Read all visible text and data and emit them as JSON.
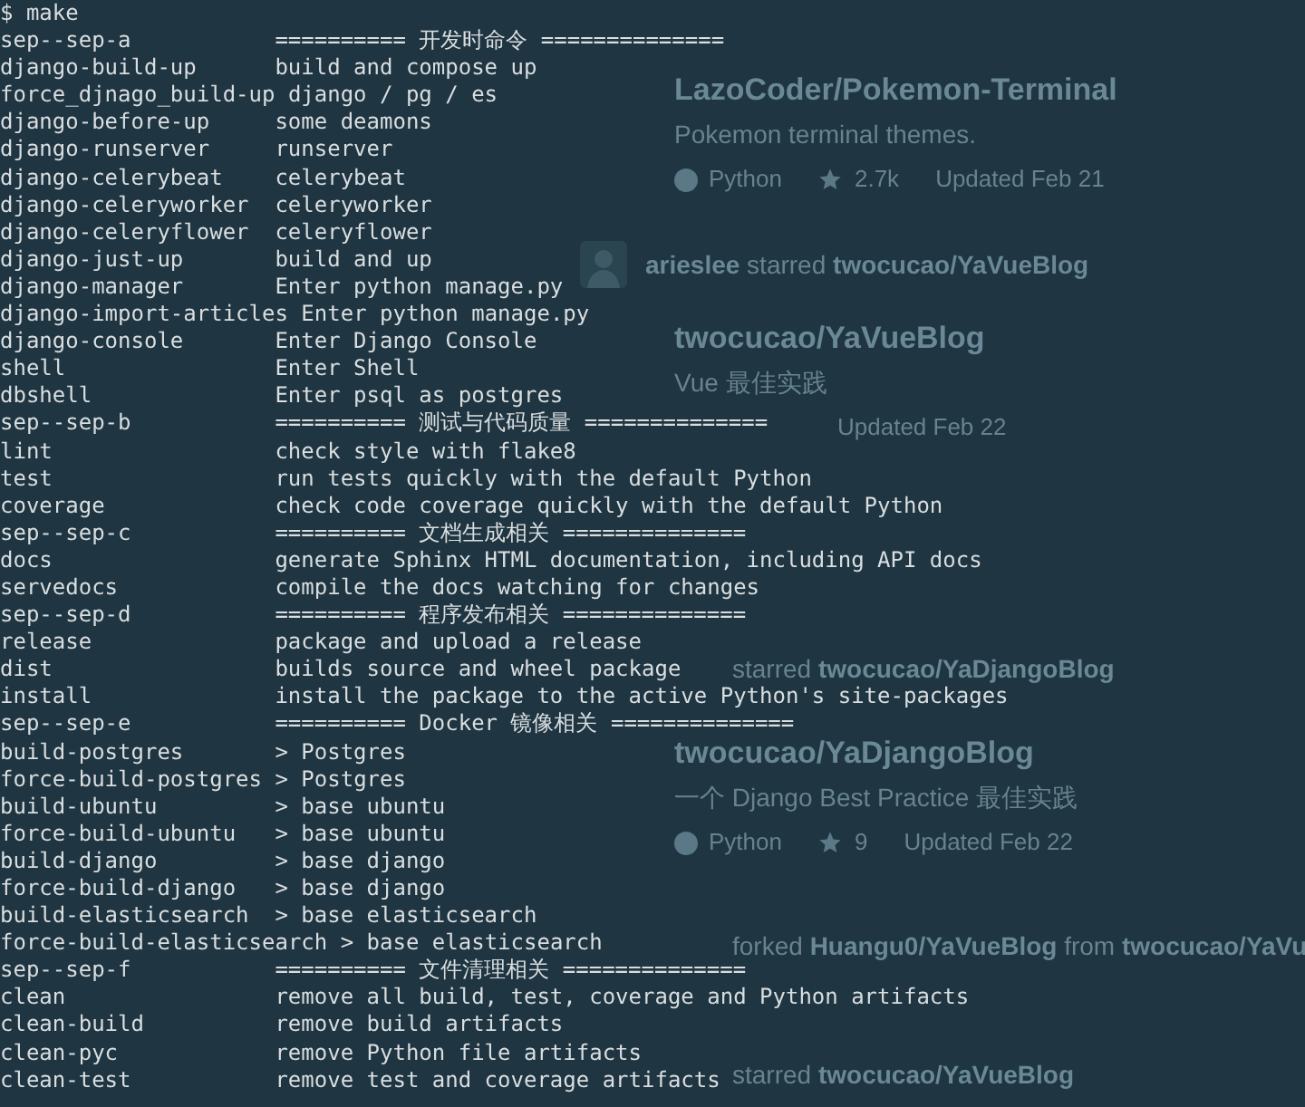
{
  "prompt": "$ make",
  "lines": [
    {
      "name": "sep--sep-a",
      "description": "========== 开发时命令 =============="
    },
    {
      "name": "django-build-up",
      "description": "build and compose up"
    },
    {
      "name": "force_djnago_build-up",
      "description": "django / pg / es"
    },
    {
      "name": "django-before-up",
      "description": "some deamons"
    },
    {
      "name": "django-runserver",
      "description": "runserver"
    },
    {
      "name": "django-celerybeat",
      "description": "celerybeat"
    },
    {
      "name": "django-celeryworker",
      "description": "celeryworker"
    },
    {
      "name": "django-celeryflower",
      "description": "celeryflower"
    },
    {
      "name": "django-just-up",
      "description": "build and up"
    },
    {
      "name": "django-manager",
      "description": "Enter python manage.py"
    },
    {
      "name": "django-import-articles",
      "description": "Enter python manage.py"
    },
    {
      "name": "django-console",
      "description": "Enter Django Console"
    },
    {
      "name": "shell",
      "description": "Enter Shell"
    },
    {
      "name": "dbshell",
      "description": "Enter psql as postgres"
    },
    {
      "name": "sep--sep-b",
      "description": "========== 测试与代码质量 =============="
    },
    {
      "name": "lint",
      "description": "check style with flake8"
    },
    {
      "name": "test",
      "description": "run tests quickly with the default Python"
    },
    {
      "name": "coverage",
      "description": "check code coverage quickly with the default Python"
    },
    {
      "name": "sep--sep-c",
      "description": "========== 文档生成相关 =============="
    },
    {
      "name": "docs",
      "description": "generate Sphinx HTML documentation, including API docs"
    },
    {
      "name": "servedocs",
      "description": "compile the docs watching for changes"
    },
    {
      "name": "sep--sep-d",
      "description": "========== 程序发布相关 =============="
    },
    {
      "name": "release",
      "description": "package and upload a release"
    },
    {
      "name": "dist",
      "description": "builds source and wheel package"
    },
    {
      "name": "install",
      "description": "install the package to the active Python's site-packages"
    },
    {
      "name": "sep--sep-e",
      "description": "========== Docker 镜像相关 =============="
    },
    {
      "name": "build-postgres",
      "description": "> Postgres"
    },
    {
      "name": "force-build-postgres",
      "description": "> Postgres"
    },
    {
      "name": "build-ubuntu",
      "description": "> base ubuntu"
    },
    {
      "name": "force-build-ubuntu",
      "description": "> base ubuntu"
    },
    {
      "name": "build-django",
      "description": "> base django"
    },
    {
      "name": "force-build-django",
      "description": "> base django"
    },
    {
      "name": "build-elasticsearch",
      "description": "> base elasticsearch"
    },
    {
      "name": "force-build-elasticsearch",
      "description": "> base elasticsearch"
    },
    {
      "name": "sep--sep-f",
      "description": "========== 文件清理相关 =============="
    },
    {
      "name": "clean",
      "description": "remove all build, test, coverage and Python artifacts"
    },
    {
      "name": "clean-build",
      "description": "remove build artifacts"
    },
    {
      "name": "clean-pyc",
      "description": "remove Python file artifacts"
    },
    {
      "name": "clean-test",
      "description": "remove test and coverage artifacts"
    }
  ],
  "feed": [
    {
      "kind": "repo",
      "title": "LazoCoder/Pokemon-Terminal",
      "description": "Pokemon terminal themes.",
      "language": "Python",
      "star_count": "2.7k",
      "updated": "Updated Feb 21"
    },
    {
      "kind": "event",
      "avatar": true,
      "text": "**arieslee** starred **twocucao/YaVueBlog**"
    },
    {
      "kind": "repo",
      "title": "twocucao/YaVueBlog",
      "description": "Vue 最佳实践",
      "updated": "Updated Feb 22"
    },
    {
      "kind": "event",
      "avatar": false,
      "text": "starred **twocucao/YaDjangoBlog**"
    },
    {
      "kind": "repo",
      "title": "twocucao/YaDjangoBlog",
      "description": "一个 Django Best Practice 最佳实践",
      "language": "Python",
      "star_count": "9",
      "updated": "Updated Feb 22"
    },
    {
      "kind": "event",
      "avatar": false,
      "text": "forked **Huangu0/YaVueBlog** from **twocucao/YaVu**"
    },
    {
      "kind": "event",
      "avatar": false,
      "text": "starred **twocucao/YaVueBlog**"
    }
  ]
}
